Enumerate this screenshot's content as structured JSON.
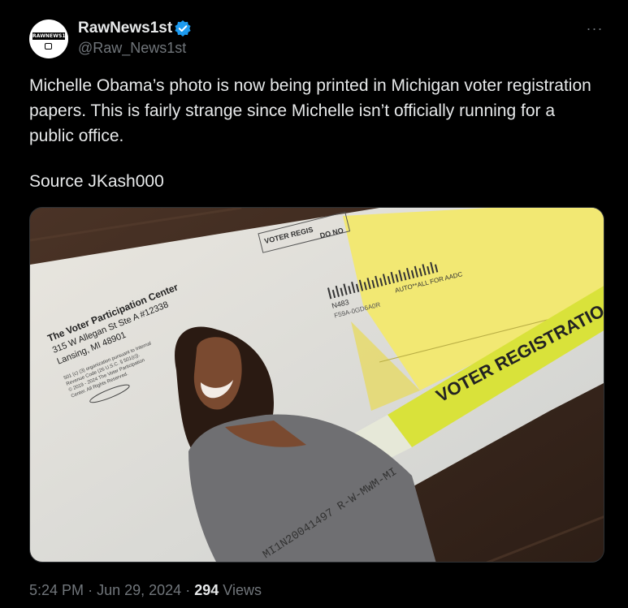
{
  "author": {
    "name": "RawNews1st",
    "handle": "@Raw_News1st",
    "avatar_text": "RAWNEWS1ST",
    "verified": true
  },
  "tweet": {
    "text": "Michelle Obama’s photo is now being printed in Michigan voter registration papers. This is fairly strange since Michelle isn’t officially running for a public office.",
    "source_line": "Source JKash000"
  },
  "media": {
    "return_address": [
      "The Voter Participation Center",
      "315 W Allegan St Ste A #12338",
      "Lansing, MI 48901"
    ],
    "fine_print": [
      "501 (c) (3) organization pursuant to Internal",
      "Revenue Code (26 U.S.C. § 501(c)).",
      "© 2019 - 2024 The Voter Participation",
      "Center. All Rights Reserved."
    ],
    "window_label_top": "VOTER REGIS",
    "window_label_sub": "DO NO",
    "barcode_code_1": "N483",
    "barcode_code_2": "F59A-0GD6A0R",
    "barcode_auto": "AUTO**ALL FOR AADC",
    "banner": "VOTER REGISTRATIO",
    "tracking_code": "MI1N20041497  R-W-MWM-MI"
  },
  "meta": {
    "time": "5:24 PM",
    "sep": "·",
    "date": "Jun 29, 2024",
    "views_count": "294",
    "views_label": "Views"
  },
  "colors": {
    "background": "#000000",
    "text": "#e7e9ea",
    "muted": "#71767b",
    "verified": "#1d9bf0",
    "banner": "#d9e23a"
  }
}
